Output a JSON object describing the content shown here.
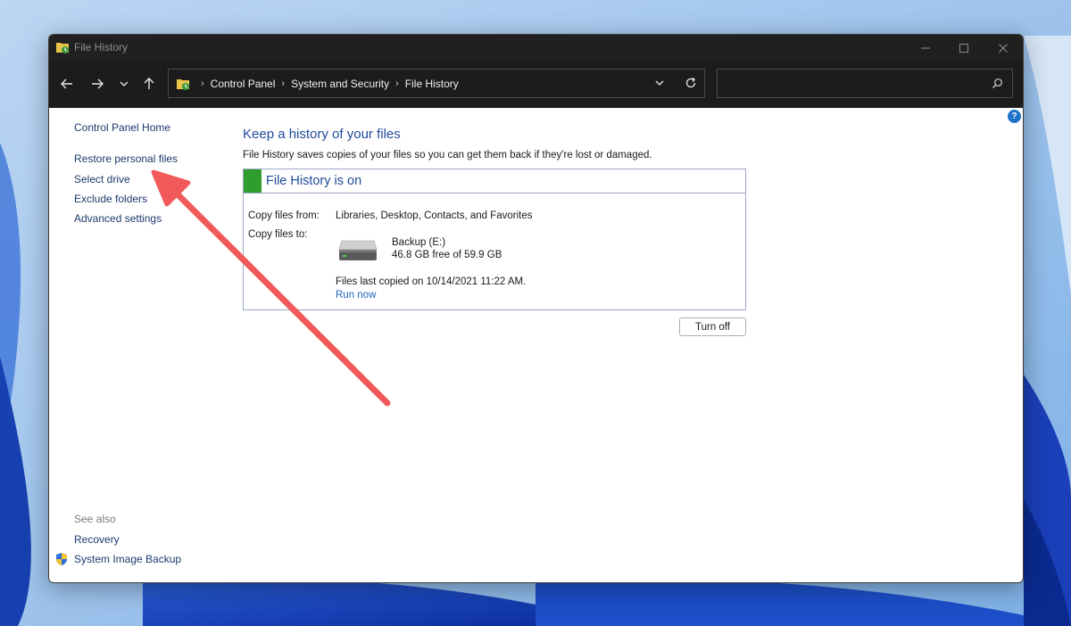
{
  "window": {
    "title": "File History"
  },
  "addressbar": {
    "breadcrumbs": [
      "Control Panel",
      "System and Security",
      "File History"
    ],
    "search_placeholder": ""
  },
  "sidebar": {
    "home_link": "Control Panel Home",
    "links": [
      "Restore personal files",
      "Select drive",
      "Exclude folders",
      "Advanced settings"
    ],
    "see_also_label": "See also",
    "see_also": [
      "Recovery",
      "System Image Backup"
    ]
  },
  "main": {
    "title": "Keep a history of your files",
    "description": "File History saves copies of your files so you can get them back if they're lost or damaged.",
    "status_title": "File History is on",
    "copy_from_label": "Copy files from:",
    "copy_from_value": "Libraries, Desktop, Contacts, and Favorites",
    "copy_to_label": "Copy files to:",
    "drive_name": "Backup (E:)",
    "drive_space": "46.8 GB free of 59.9 GB",
    "last_copied": "Files last copied on 10/14/2021 11:22 AM.",
    "run_now": "Run now",
    "turn_off_label": "Turn off",
    "help_glyph": "?"
  },
  "colors": {
    "status_accent": "#2f9e2f",
    "link_blue": "#1e4a9a",
    "annotation_arrow": "#f05a5a"
  },
  "icons": [
    "file-history-icon",
    "minimize-icon",
    "maximize-icon",
    "close-icon",
    "back-arrow-icon",
    "forward-arrow-icon",
    "recent-dropdown-icon",
    "up-arrow-icon",
    "chevron-down-icon",
    "refresh-icon",
    "search-icon",
    "help-icon",
    "hard-drive-icon",
    "shield-icon"
  ]
}
